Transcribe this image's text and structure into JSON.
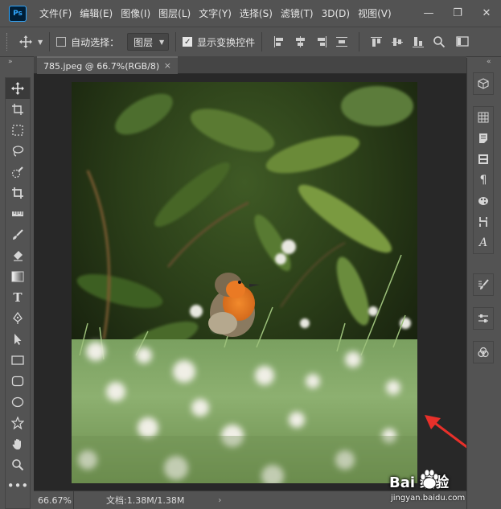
{
  "app": {
    "logo_text": "Ps"
  },
  "menu": [
    "文件(F)",
    "编辑(E)",
    "图像(I)",
    "图层(L)",
    "文字(Y)",
    "选择(S)",
    "滤镜(T)",
    "3D(D)",
    "视图(V)"
  ],
  "window_controls": {
    "minimize": "—",
    "maximize": "❐",
    "close": "✕"
  },
  "options_bar": {
    "auto_select_label": "自动选择：",
    "auto_select_checked": false,
    "target_value": "图层",
    "show_transform_label": "显示变换控件",
    "show_transform_checked": true
  },
  "document": {
    "tab_title": "785.jpeg @ 66.7%(RGB/8)",
    "tab_close": "×"
  },
  "status": {
    "zoom": "66.67%",
    "doc_size": "文档:1.38M/1.38M",
    "arrow": "›"
  },
  "tools": [
    "move",
    "artboard",
    "marquee",
    "lasso",
    "quick-select",
    "crop",
    "ruler",
    "brush",
    "eraser",
    "gradient",
    "type",
    "pen",
    "path-select",
    "rectangle",
    "rounded-rect",
    "ellipse",
    "custom-shape",
    "hand",
    "zoom",
    "more"
  ],
  "watermark": {
    "brand": "Bai  经验",
    "url": "jingyan.baidu.com"
  },
  "colors": {
    "chrome": "#535353",
    "canvas": "#282828",
    "accent": "#31a8ff",
    "annotation_arrow": "#e8302a"
  }
}
